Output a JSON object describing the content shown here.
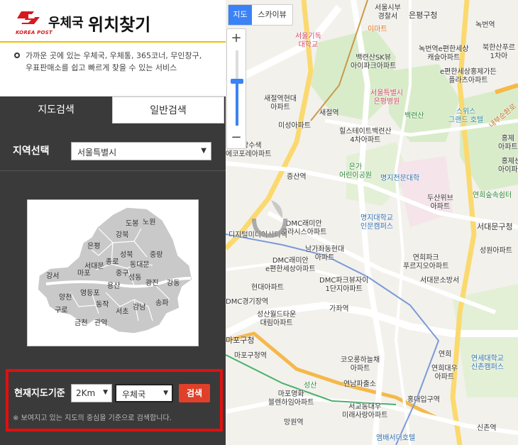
{
  "header": {
    "logo_text": "KOREA POST",
    "title_post": "우체국",
    "title_find": "위치찾기"
  },
  "description": "가까운 곳에 있는 우체국, 우체통, 365코너, 무인창구, 우표판매소를 쉽고 빠르게 찾을 수 있는 서비스",
  "tabs": [
    {
      "label": "지도검색",
      "active": true
    },
    {
      "label": "일반검색",
      "active": false
    }
  ],
  "region": {
    "label": "지역선택",
    "selected": "서울특별시"
  },
  "districts": [
    "도봉",
    "노원",
    "강북",
    "은평",
    "성북",
    "중랑",
    "종로",
    "동대문",
    "서대문",
    "마포",
    "중구",
    "성동",
    "광진",
    "강동",
    "강서",
    "용산",
    "양천",
    "영등포",
    "동작",
    "송파",
    "구로",
    "강남",
    "서초",
    "금천",
    "관악"
  ],
  "current": {
    "label": "현재지도기준",
    "distance": "2Km",
    "type": "우체국",
    "search_label": "검색",
    "note": "※ 보여지고 있는 지도의 중심을 기준으로 검색합니다."
  },
  "map_controls": {
    "type_map": "지도",
    "type_sky": "스카이뷰",
    "zoom_in": "+",
    "zoom_out": "−"
  },
  "map_places": [
    "서울시부",
    "경찰서",
    "은평구청",
    "녹번역",
    "북한산푸르",
    "1차아",
    "서울기독",
    "대학교",
    "이마트",
    "백련산SK뷰",
    "아이파크아파트",
    "녹번역e편한세상",
    "캐슬아파트",
    "e편한세상홍제가든",
    "플라츠아파트",
    "새절역현대",
    "아파트",
    "서울특별시",
    "은평병원",
    "백련산",
    "스위스",
    "그랜드 호텔",
    "내부순환로",
    "새절역",
    "미성아파트",
    "힐스테이트백련산",
    "4차아파트",
    "홍제",
    "아파트",
    "홍제센",
    "아이파크",
    "세상수색",
    "에코포레아파트",
    "은가",
    "어린이공원",
    "명지전문대학",
    "증산역",
    "두산위브",
    "아파트",
    "연희숲속쉼터",
    "DMC래미안",
    "클라시스아파트",
    "명지대학교",
    "인문캠퍼스",
    "서대문구청",
    "성원아파트",
    "남가좌동현대",
    "아파트",
    "연희파크",
    "푸르지오아파트",
    "DMC래미안",
    "e편한세상아파트",
    "DMC파크뷰자이",
    "1단지아파트",
    "서대문소방서",
    "현대아파트",
    "가좌역",
    "DMC경기장역",
    "성산월드타운",
    "대림아파트",
    "가좌역",
    "마포구청",
    "마포구청역",
    "코오롱하늘채",
    "아파트",
    "연세대학교",
    "신촌캠퍼스",
    "연희",
    "연희대우",
    "아파트",
    "연남파출소",
    "성산",
    "마포영화",
    "블렌하임아파트",
    "홍대입구역",
    "서교동대우",
    "미래사랑아파트",
    "망원역",
    "신촌역",
    "앰배서더호텔",
    "신촌",
    "디지털미디어시티역",
    "현대",
    "연희",
    "연희"
  ]
}
